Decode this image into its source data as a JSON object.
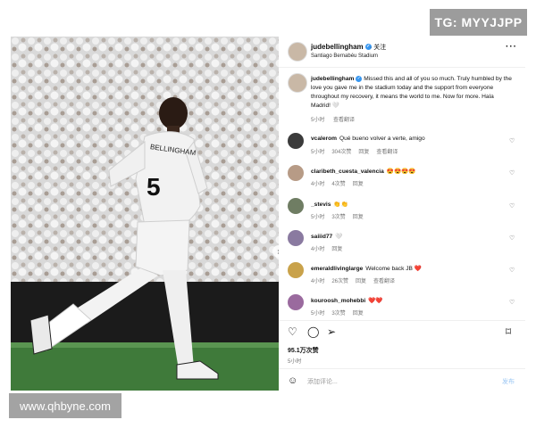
{
  "watermarks": {
    "top": "TG: MYYJJPP",
    "bottom": "www.qhbyne.com"
  },
  "post": {
    "author": "judebellingham",
    "follow_label": "· 关注",
    "location": "Santiago Bernabéu Stadium",
    "more_label": "···",
    "caption": "Missed this and all of you so much. Truly humbled by the love you gave me in the stadium today and the support from everyone throughout my recovery, it means the world to me. Now for more. Hala Madrid! 🤍",
    "caption_time": "5小时",
    "caption_translation": "查看翻译",
    "jersey_name": "BELLINGHAM",
    "jersey_number": "5"
  },
  "comments": [
    {
      "user": "vcalerom",
      "text": "Qué bueno volver a verte, amigo",
      "time": "5小时",
      "likes": "304次赞",
      "reply": "回复",
      "translate": "查看翻译",
      "avatar_color": "#3b3b3b"
    },
    {
      "user": "claribeth_cuesta_valencia",
      "text": "😍😍😍😍",
      "time": "4小时",
      "likes": "4次赞",
      "reply": "回复",
      "translate": "",
      "avatar_color": "#b79b86"
    },
    {
      "user": "_stevis",
      "text": "👏👏",
      "time": "5小时",
      "likes": "3次赞",
      "reply": "回复",
      "translate": "",
      "avatar_color": "#6f7d63"
    },
    {
      "user": "saiiid77",
      "text": "🤍",
      "time": "4小时",
      "likes": "",
      "reply": "回复",
      "translate": "",
      "avatar_color": "#8a7aa0"
    },
    {
      "user": "emeraldlivinglarge",
      "text": "Welcome back JB ❤️",
      "time": "4小时",
      "likes": "26次赞",
      "reply": "回复",
      "translate": "查看翻译",
      "avatar_color": "#c9a24a"
    },
    {
      "user": "kouroosh_mohebbi",
      "text": "❤️❤️",
      "time": "5小时",
      "likes": "3次赞",
      "reply": "回复",
      "translate": "",
      "avatar_color": "#9a6a9e"
    }
  ],
  "actions": {
    "like_icon": "heart-icon",
    "comment_icon": "comment-icon",
    "share_icon": "share-icon",
    "save_icon": "bookmark-icon"
  },
  "likes_count": "95.1万次赞",
  "post_time": "5小时",
  "composer": {
    "placeholder": "添加评论...",
    "post_label": "发布"
  }
}
